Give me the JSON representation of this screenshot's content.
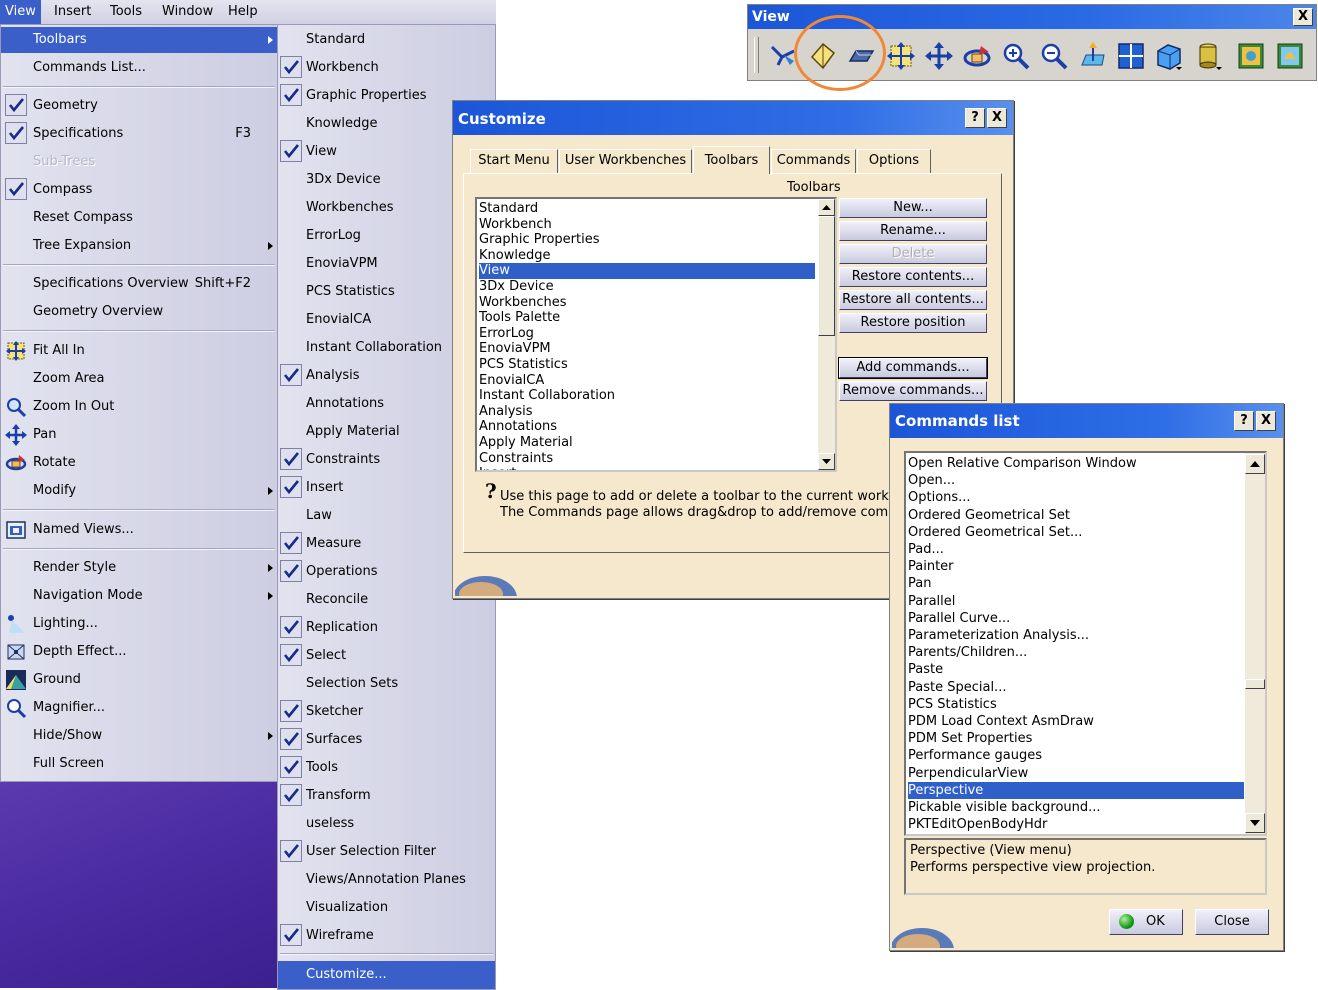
{
  "menubar": {
    "items": [
      "View",
      "Insert",
      "Tools",
      "Window",
      "Help"
    ]
  },
  "view_menu": {
    "items": [
      {
        "label": "Toolbars"
      },
      {
        "label": "Commands List..."
      },
      {
        "label": "Geometry"
      },
      {
        "label": "Specifications",
        "shortcut": "F3"
      },
      {
        "label": "Sub-Trees"
      },
      {
        "label": "Compass"
      },
      {
        "label": "Reset Compass"
      },
      {
        "label": "Tree Expansion"
      },
      {
        "label": "Specifications Overview",
        "shortcut": "Shift+F2"
      },
      {
        "label": "Geometry Overview"
      },
      {
        "label": "Fit All In"
      },
      {
        "label": "Zoom Area"
      },
      {
        "label": "Zoom In Out"
      },
      {
        "label": "Pan"
      },
      {
        "label": "Rotate"
      },
      {
        "label": "Modify"
      },
      {
        "label": "Named Views..."
      },
      {
        "label": "Render Style"
      },
      {
        "label": "Navigation Mode"
      },
      {
        "label": "Lighting..."
      },
      {
        "label": "Depth Effect..."
      },
      {
        "label": "Ground"
      },
      {
        "label": "Magnifier..."
      },
      {
        "label": "Hide/Show"
      },
      {
        "label": "Full Screen"
      }
    ]
  },
  "toolbars_menu": {
    "items": [
      {
        "label": "Standard",
        "checked": false
      },
      {
        "label": "Workbench",
        "checked": true
      },
      {
        "label": "Graphic Properties",
        "checked": true
      },
      {
        "label": "Knowledge",
        "checked": false
      },
      {
        "label": "View",
        "checked": true
      },
      {
        "label": "3Dx Device",
        "checked": false
      },
      {
        "label": "Workbenches",
        "checked": false
      },
      {
        "label": "ErrorLog",
        "checked": false
      },
      {
        "label": "EnoviaVPM",
        "checked": false
      },
      {
        "label": "PCS Statistics",
        "checked": false
      },
      {
        "label": "EnovialCA",
        "checked": false
      },
      {
        "label": "Instant Collaboration",
        "checked": false
      },
      {
        "label": "Analysis",
        "checked": true
      },
      {
        "label": "Annotations",
        "checked": false
      },
      {
        "label": "Apply Material",
        "checked": false
      },
      {
        "label": "Constraints",
        "checked": true
      },
      {
        "label": "Insert",
        "checked": true
      },
      {
        "label": "Law",
        "checked": false
      },
      {
        "label": "Measure",
        "checked": true
      },
      {
        "label": "Operations",
        "checked": true
      },
      {
        "label": "Reconcile",
        "checked": false
      },
      {
        "label": "Replication",
        "checked": true
      },
      {
        "label": "Select",
        "checked": true
      },
      {
        "label": "Selection Sets",
        "checked": false
      },
      {
        "label": "Sketcher",
        "checked": true
      },
      {
        "label": "Surfaces",
        "checked": true
      },
      {
        "label": "Tools",
        "checked": true
      },
      {
        "label": "Transform",
        "checked": true
      },
      {
        "label": "useless",
        "checked": false
      },
      {
        "label": "User Selection Filter",
        "checked": true
      },
      {
        "label": "Views/Annotation Planes",
        "checked": false
      },
      {
        "label": "Visualization",
        "checked": false
      },
      {
        "label": "Wireframe",
        "checked": true
      }
    ],
    "customize_label": "Customize..."
  },
  "view_toolbar": {
    "title": "View",
    "close": "X",
    "icons": [
      "fly-mode-icon",
      "examine-mode-icon",
      "walk-mode-icon",
      "fit-all-in-icon",
      "pan-icon",
      "rotate-icon",
      "zoom-in-icon",
      "zoom-out-icon",
      "normal-view-icon",
      "multi-view-icon",
      "iso-view-icon",
      "render-style-icon",
      "hide-show-icon",
      "swap-visible-space-icon"
    ]
  },
  "customize": {
    "title": "Customize",
    "help_btn": "?",
    "close_btn": "X",
    "tabs": [
      "Start Menu",
      "User Workbenches",
      "Toolbars",
      "Commands",
      "Options"
    ],
    "list_caption": "Toolbars",
    "list": [
      "Standard",
      "Workbench",
      "Graphic Properties",
      "Knowledge",
      "View",
      "3Dx Device",
      "Workbenches",
      "Tools Palette",
      "ErrorLog",
      "EnoviaVPM",
      "PCS Statistics",
      "EnovialCA",
      "Instant Collaboration",
      "Analysis",
      "Annotations",
      "Apply Material",
      "Constraints",
      "Insert"
    ],
    "selected_index": 4,
    "buttons": [
      "New...",
      "Rename...",
      "Delete",
      "Restore contents...",
      "Restore all contents...",
      "Restore position",
      "Add commands...",
      "Remove commands..."
    ],
    "help_line1": "Use this page to add or delete a toolbar to the current workbench.",
    "help_line2": "The Commands page allows drag&drop to add/remove commands."
  },
  "commands_list": {
    "title": "Commands list",
    "help_btn": "?",
    "close_btn": "X",
    "list": [
      "Open Relative Comparison Window",
      "Open...",
      "Options...",
      "Ordered Geometrical Set",
      "Ordered Geometrical Set...",
      "Pad...",
      "Painter",
      "Pan",
      "Parallel",
      "Parallel Curve...",
      "Parameterization Analysis...",
      "Parents/Children...",
      "Paste",
      "Paste Special...",
      "PCS Statistics",
      "PDM Load Context AsmDraw",
      "PDM Set Properties",
      "Performance gauges",
      "PerpendicularView",
      "Perspective",
      "Pickable visible background...",
      "PKTEditOpenBodyHdr"
    ],
    "selected_index": 19,
    "desc_line1": "Perspective (View menu)",
    "desc_line2": "Performs perspective view projection.",
    "ok_label": "OK",
    "close_label": "Close"
  },
  "colors": {
    "title_bar": "#1c56d8",
    "selection": "#3a5fc8",
    "dialog_bg": "#f6e8cc",
    "highlight_circle": "#f08838",
    "desktop": "#4a2aa0"
  }
}
